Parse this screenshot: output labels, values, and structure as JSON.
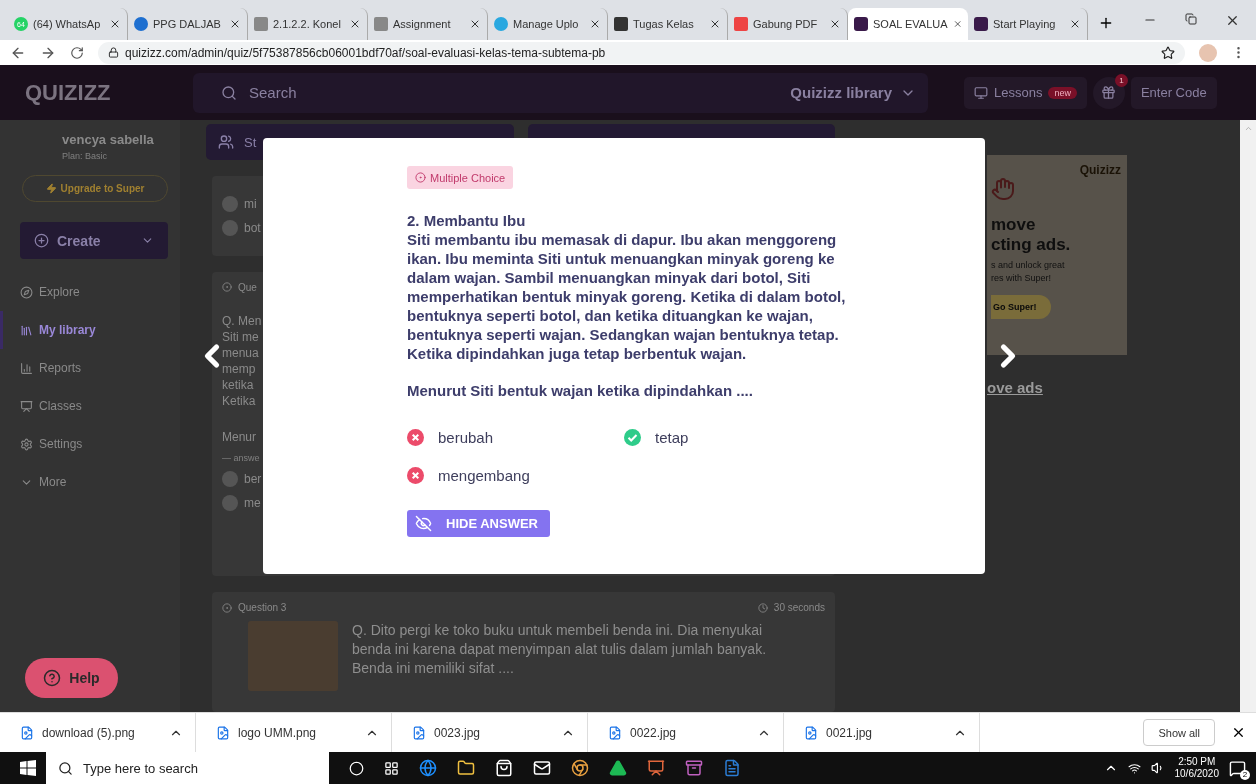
{
  "browser": {
    "tabs": [
      {
        "title": "(64) WhatsAp",
        "badge": "64",
        "selected": false
      },
      {
        "title": "PPG DALJAB",
        "selected": false
      },
      {
        "title": "2.1.2.2. Konel",
        "selected": false
      },
      {
        "title": "Assignment",
        "selected": false
      },
      {
        "title": "Manage Uplo",
        "selected": false
      },
      {
        "title": "Tugas Kelas",
        "selected": false
      },
      {
        "title": "Gabung PDF",
        "selected": false
      },
      {
        "title": "SOAL EVALUA",
        "selected": true
      },
      {
        "title": "Start Playing",
        "selected": false
      }
    ],
    "url": "quizizz.com/admin/quiz/5f75387856cb06001bdf70af/soal-evaluasi-kelas-tema-subtema-pb"
  },
  "header": {
    "logo": "QUIZIZZ",
    "search_placeholder": "Search",
    "library": "Quizizz library",
    "lessons": "Lessons",
    "lessons_badge": "new",
    "gift_badge": "1",
    "enter_code": "Enter Code"
  },
  "sidebar": {
    "user": "vencya sabella",
    "plan": "Plan: Basic",
    "upgrade": "Upgrade to Super",
    "create": "Create",
    "items": [
      {
        "label": "Explore",
        "selected": false
      },
      {
        "label": "My library",
        "selected": true
      },
      {
        "label": "Reports",
        "selected": false
      },
      {
        "label": "Classes",
        "selected": false
      },
      {
        "label": "Settings",
        "selected": false
      },
      {
        "label": "More",
        "selected": false
      }
    ]
  },
  "background": {
    "start_button": "St",
    "card1_options": [
      "mi",
      "bot"
    ],
    "card2": {
      "tag": "Que",
      "lines": [
        "Q. Men",
        "Siti me",
        "menua",
        "memp",
        "ketika",
        "Ketika"
      ],
      "prompt": "Menur",
      "answers_label": "— answe",
      "options": [
        "ber",
        "me"
      ]
    },
    "card3": {
      "label": "Question 3",
      "time": "30 seconds",
      "text": "Q. Dito pergi ke toko buku untuk membeli benda ini. Dia menyukai benda ini karena dapat menyimpan alat tulis dalam jumlah banyak. Benda ini memiliki sifat ...."
    }
  },
  "ad": {
    "logo": "Quizizz",
    "headline": [
      "move",
      "cting ads."
    ],
    "body": [
      "s and unlock great",
      "res with Super!"
    ],
    "button": "Go Super!",
    "link": "ove ads"
  },
  "modal": {
    "type": "Multiple Choice",
    "title": "2. Membantu Ibu",
    "lines": [
      "Siti membantu ibu memasak di dapur. Ibu akan menggoreng",
      "ikan. Ibu meminta Siti untuk menuangkan minyak goreng ke",
      "dalam wajan. Sambil menuangkan minyak dari botol, Siti",
      "memperhatikan bentuk minyak goreng. Ketika di dalam botol,",
      "bentuknya seperti botol, dan ketika dituangkan ke wajan,",
      "bentuknya seperti wajan. Sedangkan wajan bentuknya tetap.",
      "Ketika dipindahkan juga tetap berbentuk wajan."
    ],
    "question": "Menurut Siti bentuk wajan ketika dipindahkan ....",
    "options": [
      {
        "text": "berubah",
        "correct": false
      },
      {
        "text": "tetap",
        "correct": true
      },
      {
        "text": "mengembang",
        "correct": false
      }
    ],
    "hide_button": "HIDE ANSWER"
  },
  "help": "Help",
  "downloads": {
    "items": [
      "download (5).png",
      "logo UMM.png",
      "0023.jpg",
      "0022.jpg",
      "0021.jpg"
    ],
    "show_all": "Show all"
  },
  "taskbar": {
    "search_placeholder": "Type here to search",
    "time": "2:50 PM",
    "date": "10/6/2020",
    "notifications": "2"
  }
}
